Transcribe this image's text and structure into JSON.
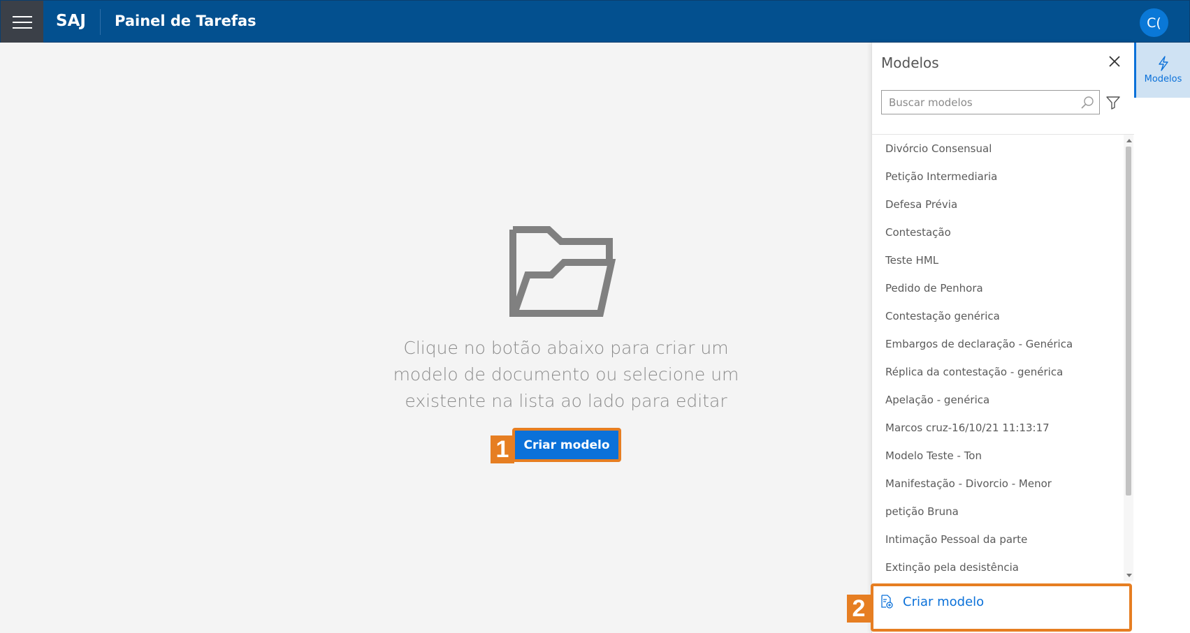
{
  "header": {
    "brand": "SAJ",
    "title": "Painel de Tarefas",
    "avatar_initials": "C("
  },
  "main": {
    "empty_message": "Clique no botão abaixo para criar um modelo de documento ou selecione um existente na lista ao lado para editar",
    "create_button_label": "Criar modelo",
    "callout_1": "1"
  },
  "panel": {
    "title": "Modelos",
    "search_placeholder": "Buscar modelos",
    "items": [
      {
        "label": "Divórcio Consensual"
      },
      {
        "label": "Petição Intermediaria"
      },
      {
        "label": "Defesa Prévia"
      },
      {
        "label": "Contestação"
      },
      {
        "label": "Teste HML"
      },
      {
        "label": "Pedido de Penhora"
      },
      {
        "label": "Contestação genérica"
      },
      {
        "label": "Embargos de declaração - Genérica"
      },
      {
        "label": "Réplica da contestação - genérica"
      },
      {
        "label": "Apelação - genérica"
      },
      {
        "label": "Marcos cruz-16/10/21 11:13:17"
      },
      {
        "label": "Modelo Teste - Ton"
      },
      {
        "label": "Manifestação - Divorcio - Menor"
      },
      {
        "label": "petição Bruna"
      },
      {
        "label": "Intimação Pessoal da parte"
      },
      {
        "label": "Extinção pela desistência"
      }
    ],
    "footer_button_label": "Criar modelo",
    "callout_2": "2"
  },
  "rail": {
    "tab_label": "Modelos",
    "tab_icon": "lightning-icon"
  },
  "colors": {
    "header_bg": "#03508f",
    "accent": "#0b71d9",
    "callout": "#e67e22"
  }
}
